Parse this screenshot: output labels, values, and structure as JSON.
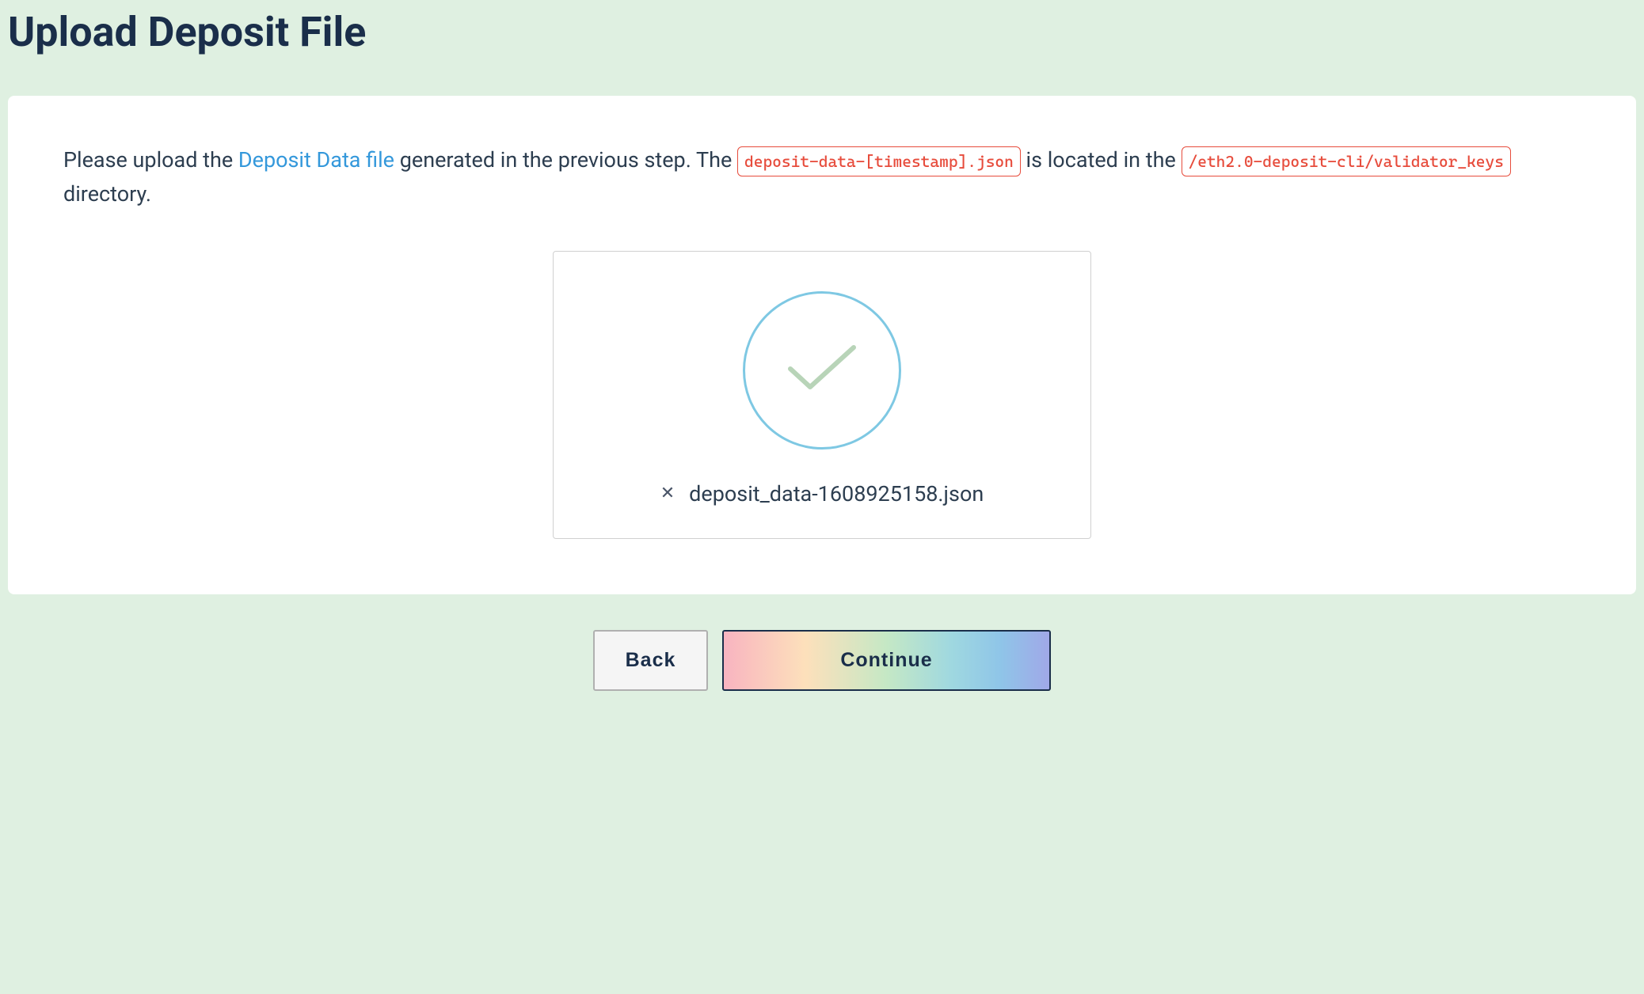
{
  "title": "Upload Deposit File",
  "instruction": {
    "text_before_link": "Please upload the ",
    "link_text": "Deposit Data file",
    "text_after_link": " generated in the previous step. The ",
    "code_filename": "deposit-data-[timestamp].json",
    "text_middle": " is located in the ",
    "code_path": "/eth2.0-deposit-cli/validator_keys",
    "text_end": " directory."
  },
  "uploaded_file": {
    "name": "deposit_data-1608925158.json"
  },
  "buttons": {
    "back": "Back",
    "continue": "Continue"
  }
}
